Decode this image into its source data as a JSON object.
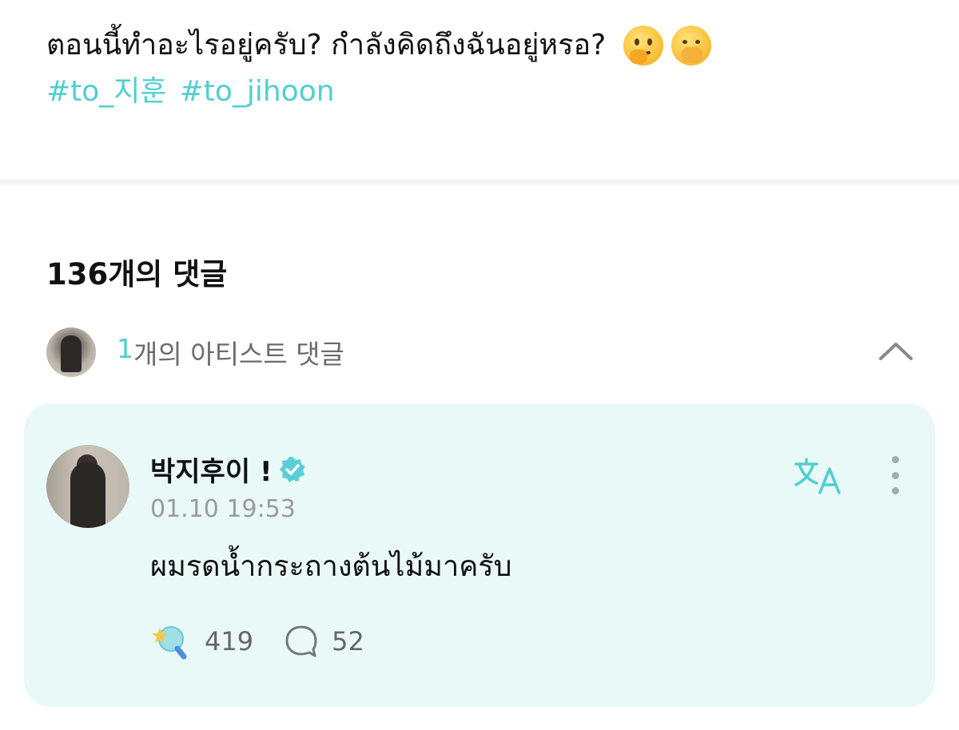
{
  "post": {
    "text": "ตอนนี้ทำอะไรอยู่ครับ? กำลังคิดถึงฉันอยู่หรอ?",
    "emojis": [
      "thinking-face",
      "face-with-hand-over-mouth"
    ],
    "hashtags": [
      "#to_지훈",
      "#to_jihoon"
    ]
  },
  "comments": {
    "heading": "136개의 댓글",
    "artist_section": {
      "count": "1",
      "label": "개의 아티스트 댓글"
    }
  },
  "artist_comment": {
    "author": "박지후이 !",
    "verified": true,
    "timestamp": "01.10 19:53",
    "body": "ผมรดน้ำกระถางต้นไม้มาครับ",
    "like_count": "419",
    "reply_count": "52"
  },
  "colors": {
    "accent": "#4fcfd0",
    "card_bg": "#e9f9f7",
    "muted": "#9a9a9a"
  }
}
